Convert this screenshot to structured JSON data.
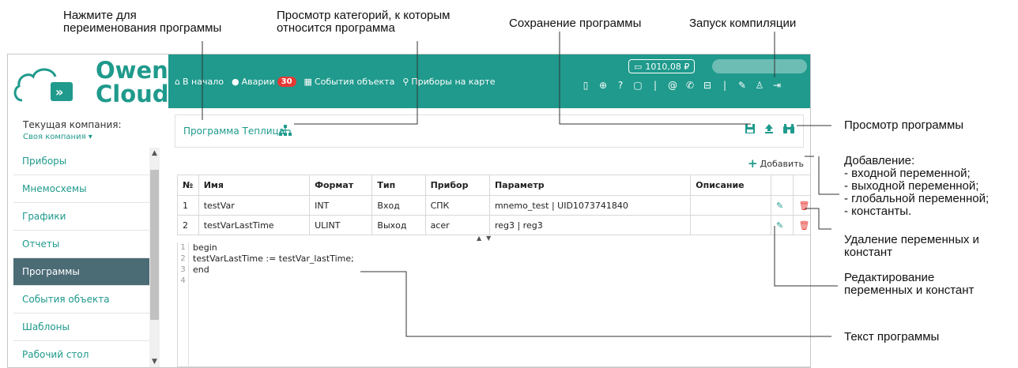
{
  "annotations": {
    "rename": "Нажмите для\nпереименования программы",
    "categories": "Просмотр категорий, к которым\nотносится программа",
    "save": "Сохранение программы",
    "compile": "Запуск компиляции",
    "view": "Просмотр программы",
    "add": "Добавление:\n- входной переменной;\n- выходной переменной;\n- глобальной переменной;\n- константы.",
    "delete": "Удаление переменных и\nконстант",
    "edit": "Редактирование\nпеременных и констант",
    "text": "Текст программы"
  },
  "logo": {
    "line1": "Owen",
    "line2": "Cloud"
  },
  "topbar": {
    "balance": "1010,08 ₽",
    "nav": [
      {
        "label": "В начало",
        "icon": "home-icon"
      },
      {
        "label": "Аварии",
        "icon": "alert-icon",
        "badge": "30"
      },
      {
        "label": "События объекта",
        "icon": "events-icon"
      },
      {
        "label": "Приборы на карте",
        "icon": "map-pin-icon"
      }
    ],
    "icons": [
      "document-icon",
      "lock-icon",
      "help-icon",
      "chat-icon",
      "separator",
      "email-icon",
      "phone-icon",
      "wallet-icon",
      "separator",
      "wrench-icon",
      "user-icon",
      "logout-icon"
    ]
  },
  "sidebar": {
    "company_label": "Текущая компания:",
    "company_value": "Своя компания ▾",
    "items": [
      "Приборы",
      "Мнемосхемы",
      "Графики",
      "Отчеты",
      "Программы",
      "События объекта",
      "Шаблоны",
      "Рабочий стол"
    ],
    "active": "Программы"
  },
  "program": {
    "name": "Программа Теплица",
    "add_label": "Добавить"
  },
  "table": {
    "headers": [
      "№",
      "Имя",
      "Формат",
      "Тип",
      "Прибор",
      "Параметр",
      "Описание",
      "",
      ""
    ],
    "rows": [
      [
        "1",
        "testVar",
        "INT",
        "Вход",
        "СПК",
        "mnemo_test | UID1073741840",
        ""
      ],
      [
        "2",
        "testVarLastTime",
        "ULINT",
        "Выход",
        "acer",
        "reg3 | reg3",
        ""
      ]
    ]
  },
  "code": {
    "lines": [
      "begin",
      "testVarLastTime := testVar_lastTime;",
      "end",
      ""
    ]
  }
}
